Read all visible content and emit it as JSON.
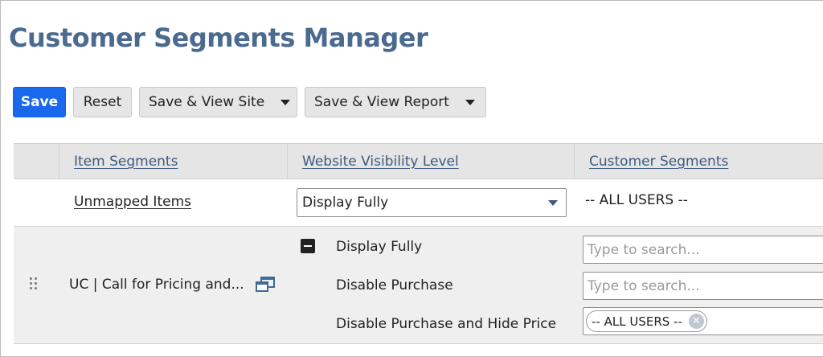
{
  "page": {
    "title": "Customer Segments Manager"
  },
  "toolbar": {
    "save_label": "Save",
    "reset_label": "Reset",
    "save_view_site_label": "Save & View Site",
    "save_view_report_label": "Save & View Report"
  },
  "table": {
    "columns": [
      "Item Segments",
      "Website Visibility Level",
      "Customer Segments"
    ],
    "rows": [
      {
        "item_segment": "Unmapped Items",
        "visibility": "Display Fully",
        "customer_segments": "-- ALL USERS --"
      },
      {
        "item_segment": "UC | Call for Pricing and...",
        "levels": [
          "Display Fully",
          "Disable Purchase",
          "Disable Purchase and Hide Price"
        ],
        "search_placeholder": "Type to search...",
        "tag": "-- ALL USERS --"
      }
    ]
  },
  "colors": {
    "title": "#4b6a90",
    "primary_button": "#1968ee",
    "link": "#3e5a80"
  },
  "icons": [
    "caret-down-icon",
    "collapse-minus-icon",
    "drag-handle-icon",
    "copy-windows-icon",
    "remove-tag-icon"
  ]
}
